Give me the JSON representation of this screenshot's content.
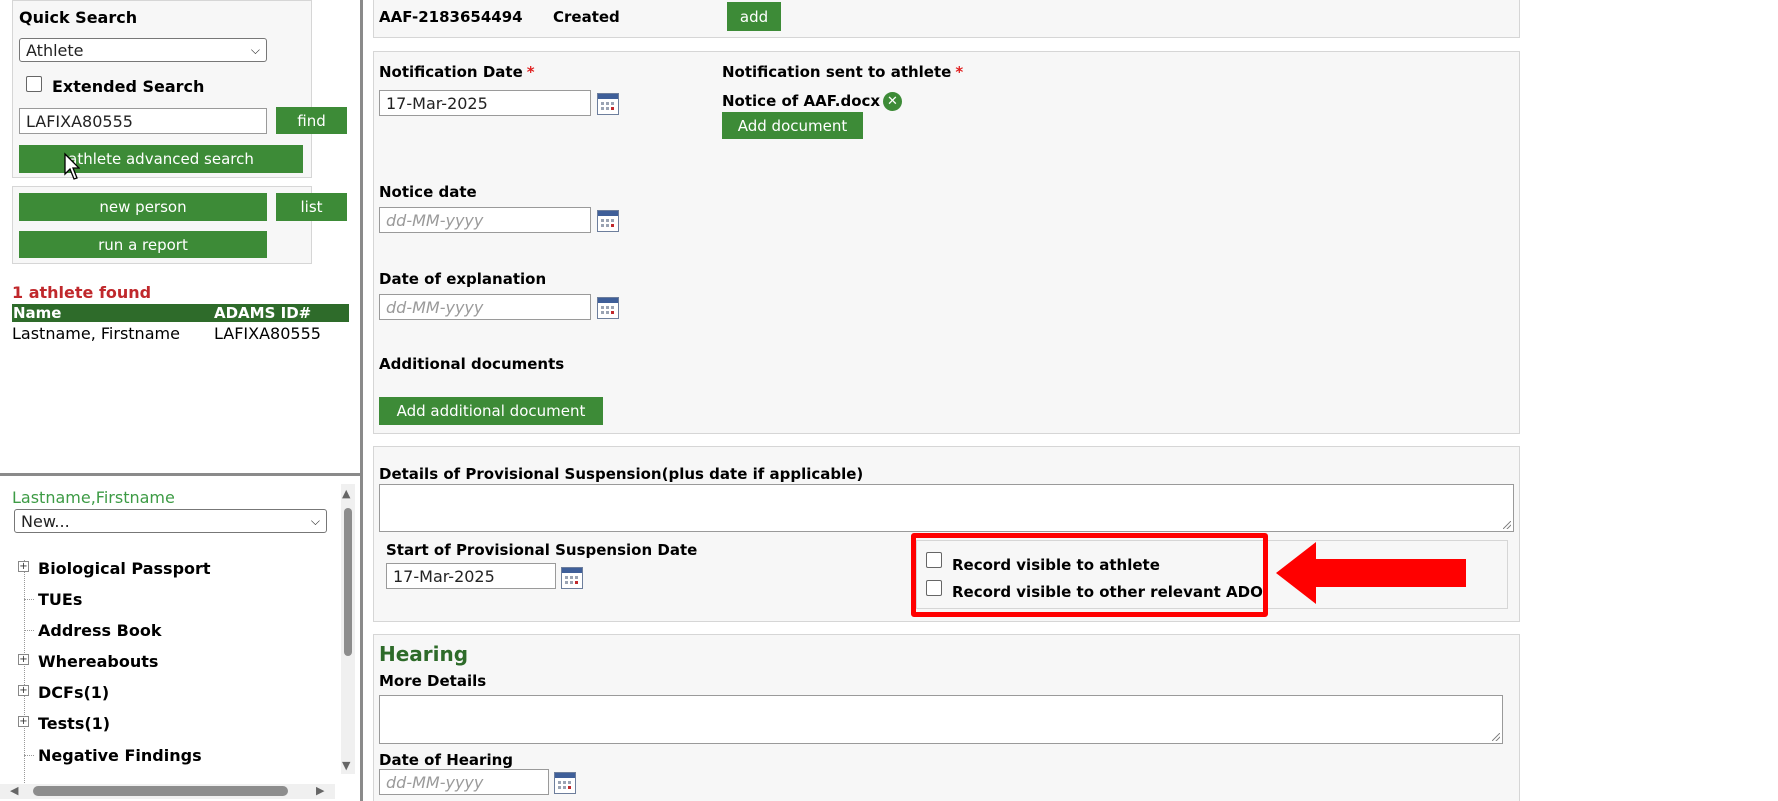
{
  "sidebar": {
    "quick_search_title": "Quick Search",
    "search_type_selected": "Athlete",
    "extended_search_label": "Extended Search",
    "search_value": "LAFIXA80555",
    "find_button": "find",
    "advanced_search_button": "athlete advanced search",
    "new_person_button": "new person",
    "list_button": "list",
    "run_report_button": "run a report",
    "results_title": "1 athlete found",
    "results_columns": [
      "Name",
      "ADAMS ID#"
    ],
    "results_rows": [
      {
        "name": "Lastname, Firstname",
        "id": "LAFIXA80555"
      }
    ],
    "athlete_link": "Lastname,Firstname",
    "new_select_selected": "New...",
    "tree_items": [
      {
        "label": "Biological Passport",
        "expandable": true
      },
      {
        "label": "TUEs",
        "expandable": false
      },
      {
        "label": "Address Book",
        "expandable": false
      },
      {
        "label": "Whereabouts",
        "expandable": true
      },
      {
        "label": "DCFs(1)",
        "expandable": true
      },
      {
        "label": "Tests(1)",
        "expandable": true
      },
      {
        "label": "Negative Findings",
        "expandable": false
      }
    ]
  },
  "top_row": {
    "case_id": "AAF-2183654494",
    "status": "Created",
    "add_button": "add"
  },
  "notification": {
    "date_label": "Notification Date",
    "required_mark": "*",
    "date_value": "17-Mar-2025",
    "sent_label": "Notification sent to athlete",
    "document_name": "Notice of AAF.docx",
    "add_document_button": "Add document",
    "notice_date_label": "Notice date",
    "notice_date_placeholder": "dd-MM-yyyy",
    "explanation_date_label": "Date of explanation",
    "explanation_date_placeholder": "dd-MM-yyyy",
    "additional_docs_label": "Additional documents",
    "add_additional_button": "Add additional document"
  },
  "suspension": {
    "details_label": "Details of Provisional Suspension(plus date if applicable)",
    "start_date_label": "Start of Provisional Suspension Date",
    "start_date_value": "17-Mar-2025",
    "visible_athlete_label": "Record visible to athlete",
    "visible_ado_label": "Record visible to other relevant ADO"
  },
  "hearing": {
    "title": "Hearing",
    "more_details_label": "More Details",
    "date_label": "Date of Hearing",
    "date_placeholder": "dd-MM-yyyy"
  },
  "colors": {
    "accent_green": "#3d8b37",
    "header_green": "#2e6b2a",
    "alert_red": "#ff0000",
    "error_red": "#c0282c"
  }
}
